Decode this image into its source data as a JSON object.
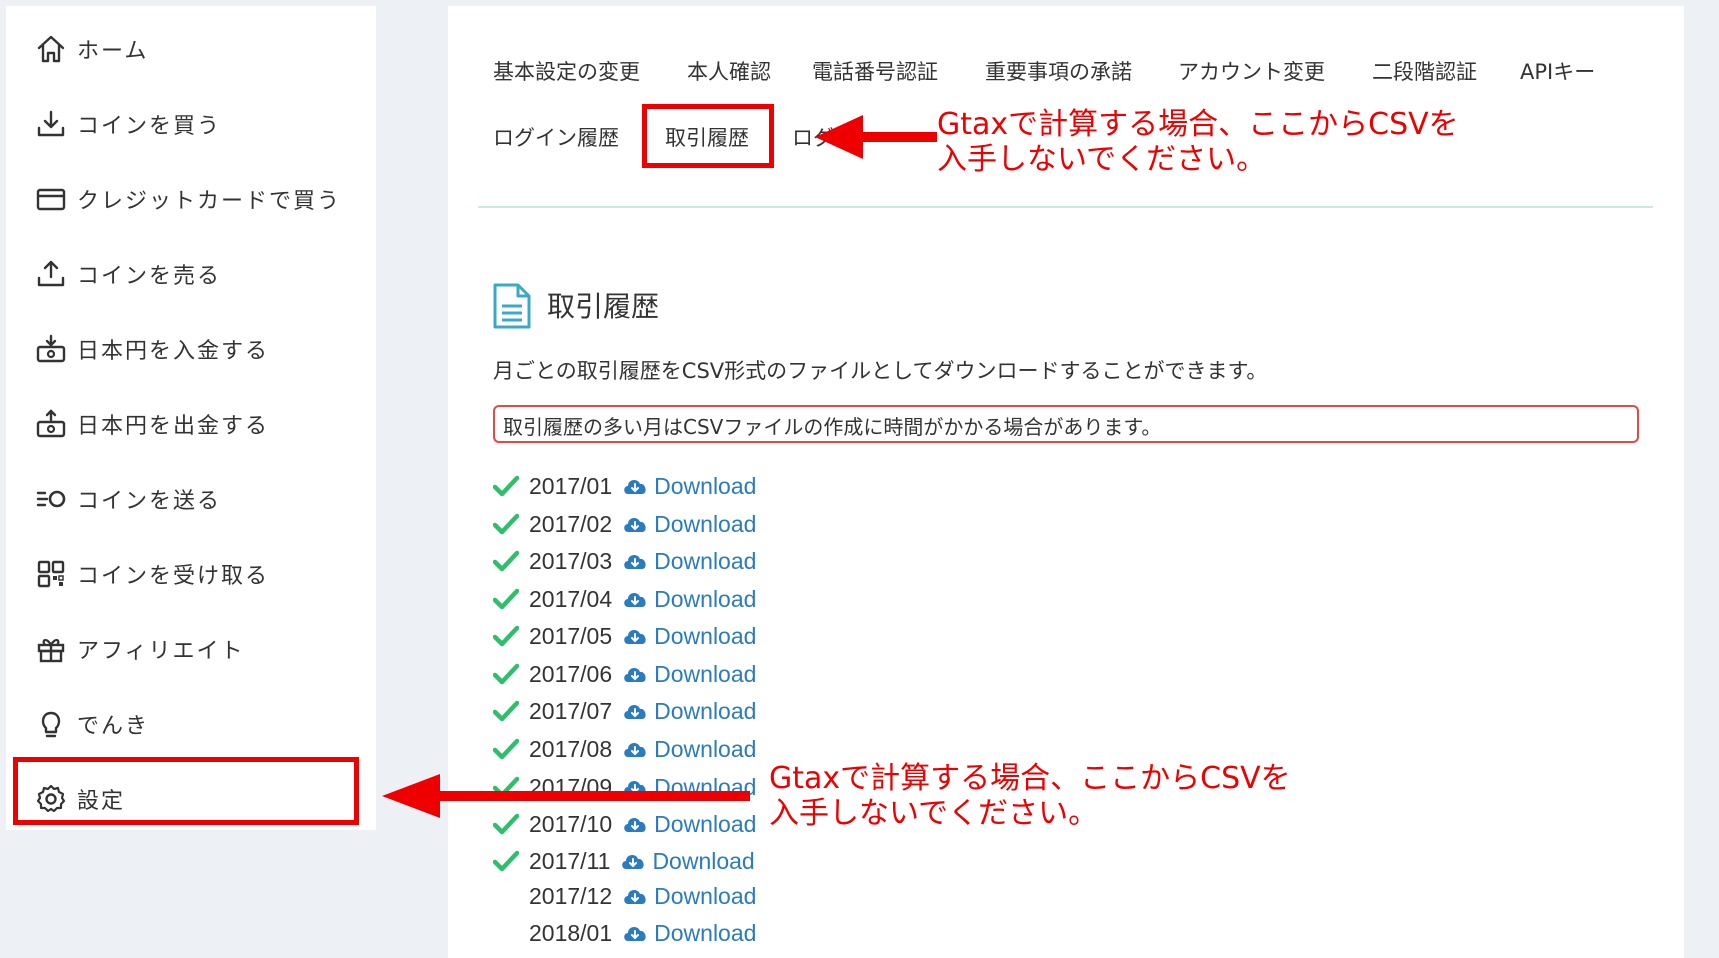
{
  "sidebar": {
    "items": [
      {
        "label": "ホーム",
        "icon": "home-icon"
      },
      {
        "label": "コインを買う",
        "icon": "download-icon"
      },
      {
        "label": "クレジットカードで買う",
        "icon": "credit-card-icon"
      },
      {
        "label": "コインを売る",
        "icon": "upload-icon"
      },
      {
        "label": "日本円を入金する",
        "icon": "deposit-icon"
      },
      {
        "label": "日本円を出金する",
        "icon": "withdraw-icon"
      },
      {
        "label": "コインを送る",
        "icon": "send-icon"
      },
      {
        "label": "コインを受け取る",
        "icon": "qr-code-icon"
      },
      {
        "label": "アフィリエイト",
        "icon": "gift-icon"
      },
      {
        "label": "でんき",
        "icon": "lightbulb-icon"
      },
      {
        "label": "設定",
        "icon": "gear-icon"
      }
    ]
  },
  "tabs": {
    "row1": [
      "基本設定の変更",
      "本人確認",
      "電話番号認証",
      "重要事項の承諾",
      "アカウント変更",
      "二段階認証",
      "APIキー"
    ],
    "row2": [
      "ログイン履歴",
      "取引履歴",
      "ログ"
    ],
    "active": "取引履歴"
  },
  "section": {
    "title": "取引履歴",
    "description": "月ごとの取引履歴をCSV形式のファイルとしてダウンロードすることができます。",
    "notice": "取引履歴の多い月はCSVファイルの作成に時間がかかる場合があります。"
  },
  "downloads": [
    {
      "month": "2017/01",
      "label": "Download",
      "checked": true
    },
    {
      "month": "2017/02",
      "label": "Download",
      "checked": true
    },
    {
      "month": "2017/03",
      "label": "Download",
      "checked": true
    },
    {
      "month": "2017/04",
      "label": "Download",
      "checked": true
    },
    {
      "month": "2017/05",
      "label": "Download",
      "checked": true
    },
    {
      "month": "2017/06",
      "label": "Download",
      "checked": true
    },
    {
      "month": "2017/07",
      "label": "Download",
      "checked": true
    },
    {
      "month": "2017/08",
      "label": "Download",
      "checked": true
    },
    {
      "month": "2017/09",
      "label": "Download",
      "checked": true
    },
    {
      "month": "2017/10",
      "label": "Download",
      "checked": true
    },
    {
      "month": "2017/11",
      "label": "Download",
      "checked": true
    },
    {
      "month": "2017/12",
      "label": "Download",
      "checked": false
    },
    {
      "month": "2018/01",
      "label": "Download",
      "checked": false
    }
  ],
  "annotations": {
    "top": [
      "Gtaxで計算する場合、ここからCSVを",
      "入手しないでください。"
    ],
    "bottom": [
      "Gtaxで計算する場合、ここからCSVを",
      "入手しないでください。"
    ]
  },
  "colors": {
    "highlight": "#e00000",
    "link": "#2a7bbf",
    "check": "#2ebf6b",
    "accent_teal": "#3aa9c9"
  }
}
